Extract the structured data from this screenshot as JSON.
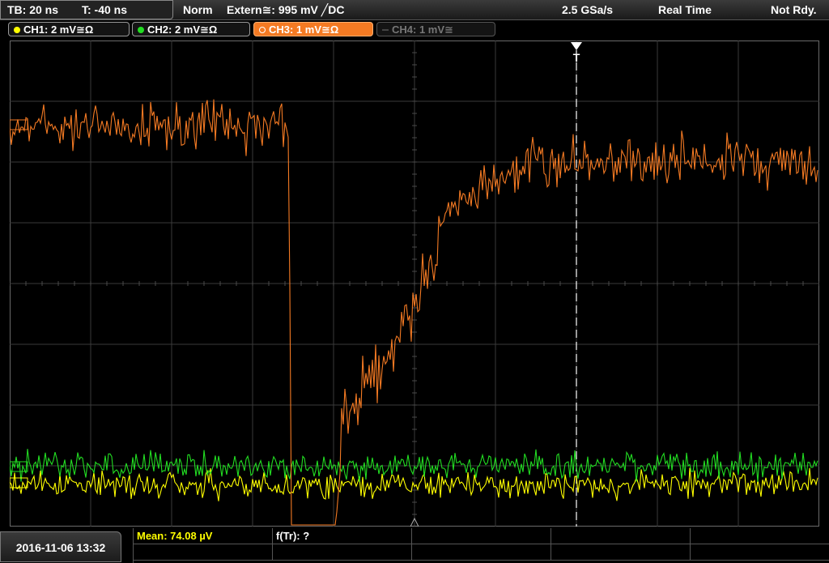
{
  "top_bar": {
    "timebase": "TB: 20 ns",
    "trigger_time": "T: -40 ns",
    "mode": "Norm",
    "trigger": "Extern≅: 995 mV ╱DC",
    "sample_rate": "2.5 GSa/s",
    "acq_mode": "Real Time",
    "status": "Not Rdy."
  },
  "channels": [
    {
      "label": "CH1: 2 mV≅Ω",
      "color": "#ffff00",
      "active": false,
      "enabled": true
    },
    {
      "label": "CH2: 2 mV≅Ω",
      "color": "#22dd22",
      "active": false,
      "enabled": true
    },
    {
      "label": "CH3: 1 mV≅Ω",
      "color": "#f47a23",
      "active": true,
      "enabled": true
    },
    {
      "label": "CH4: 1 mV≅",
      "color": "#777777",
      "active": false,
      "enabled": false
    }
  ],
  "trigger_marker": "T",
  "bottom": {
    "datetime": "2016-11-06 13:32",
    "measurement_mean": "Mean: 74.08 µV",
    "measurement_tr": "f(Tr): ?"
  },
  "colors": {
    "ch1": "#ffff00",
    "ch2": "#22dd22",
    "ch3": "#f47a23",
    "grid": "#3a3a3a",
    "measurement_text": "#ffff00"
  },
  "waveform_shape": {
    "ch3": "high noisy level, sharp drop at ~-75 ns, slow rise from ~-50 ns to ~-25 ns, settles high",
    "ch2": "noisy baseline near bottom",
    "ch1": "noisy baseline slightly below ch2"
  }
}
